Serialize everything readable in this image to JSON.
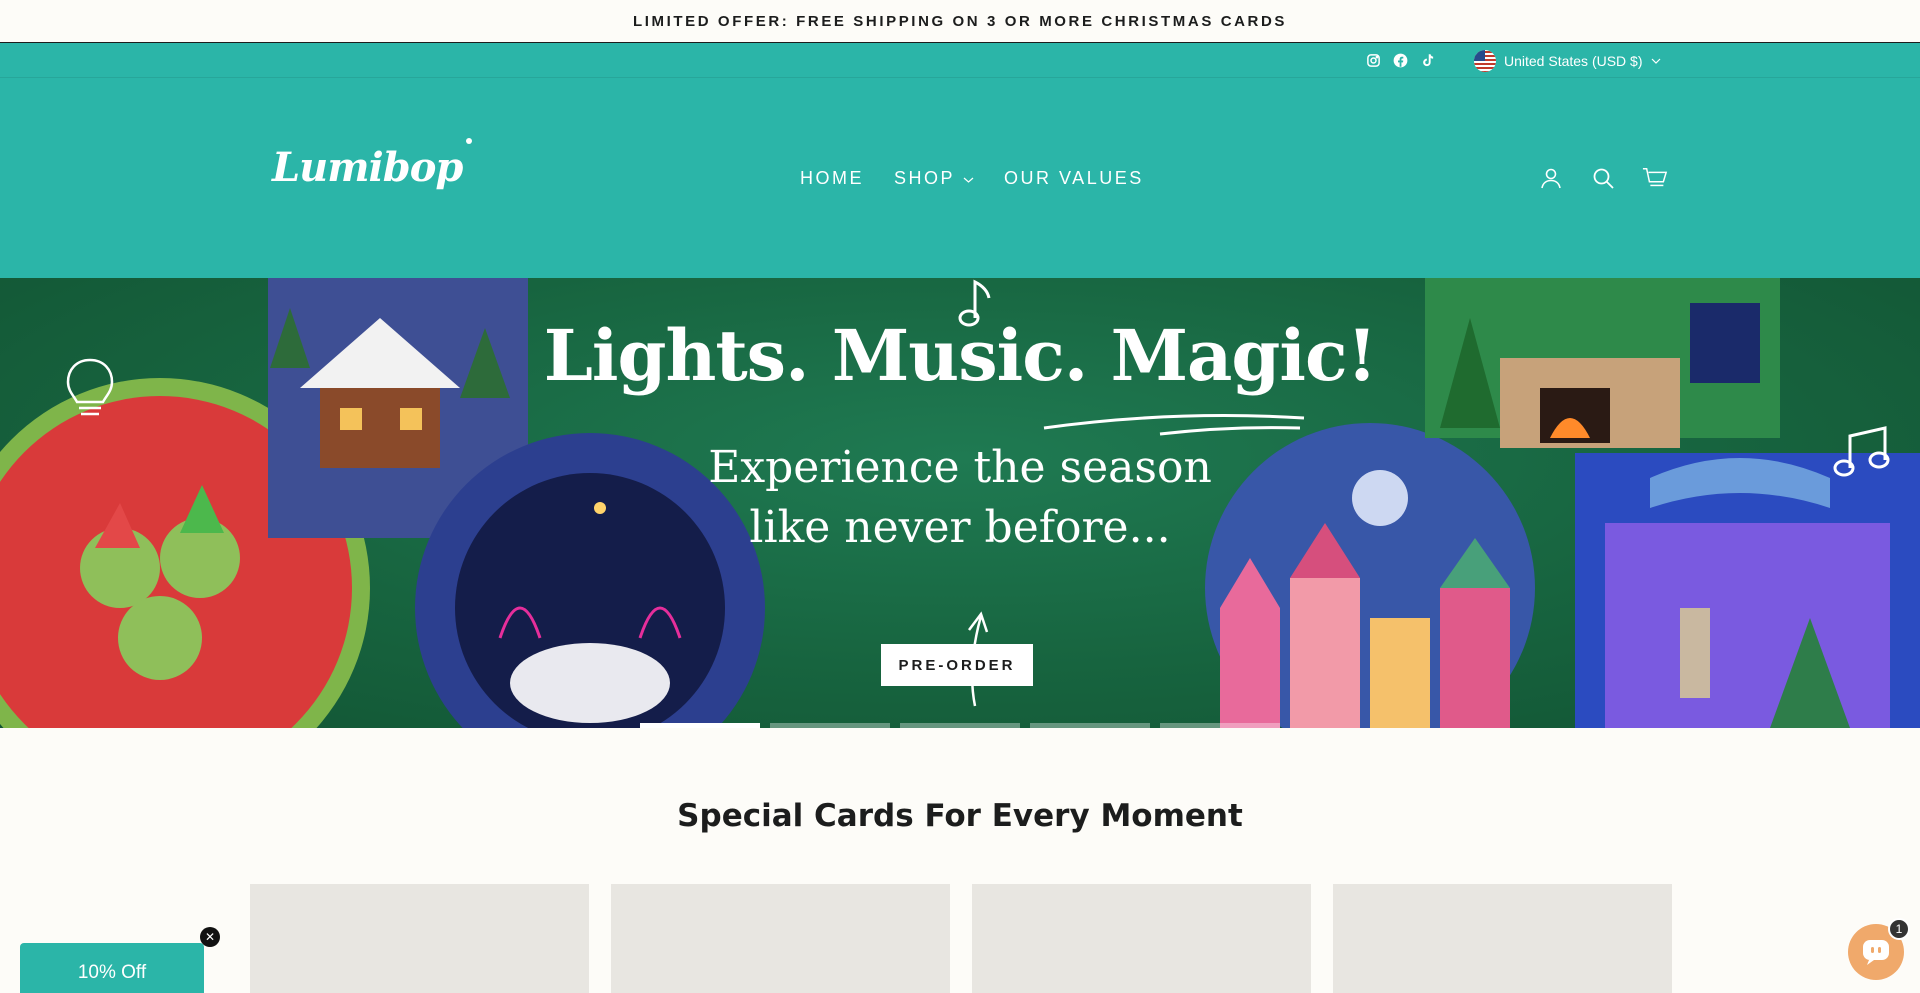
{
  "announcement": {
    "text": "LIMITED OFFER: FREE SHIPPING ON 3 OR MORE CHRISTMAS CARDS"
  },
  "utility": {
    "social": [
      "instagram-icon",
      "facebook-icon",
      "tiktok-icon"
    ],
    "country": "United States (USD $)"
  },
  "header": {
    "logo": "Lumibop",
    "nav": [
      {
        "label": "HOME"
      },
      {
        "label": "SHOP"
      },
      {
        "label": "OUR VALUES"
      }
    ],
    "icons": [
      "user-icon",
      "search-icon",
      "cart-icon"
    ]
  },
  "hero": {
    "title": "Lights. Music. Magic!",
    "subtitle_line1": "Experience the season",
    "subtitle_line2": "like never before...",
    "cta": "PRE-ORDER",
    "slides": 5,
    "active_slide": 1
  },
  "section": {
    "title": "Special Cards For Every Moment"
  },
  "offer": {
    "label": "10% Off"
  },
  "chat": {
    "badge": "1"
  },
  "colors": {
    "teal": "#2bb5a8",
    "hero_green": "#17643f",
    "card_bg": "#e8e6e1"
  }
}
